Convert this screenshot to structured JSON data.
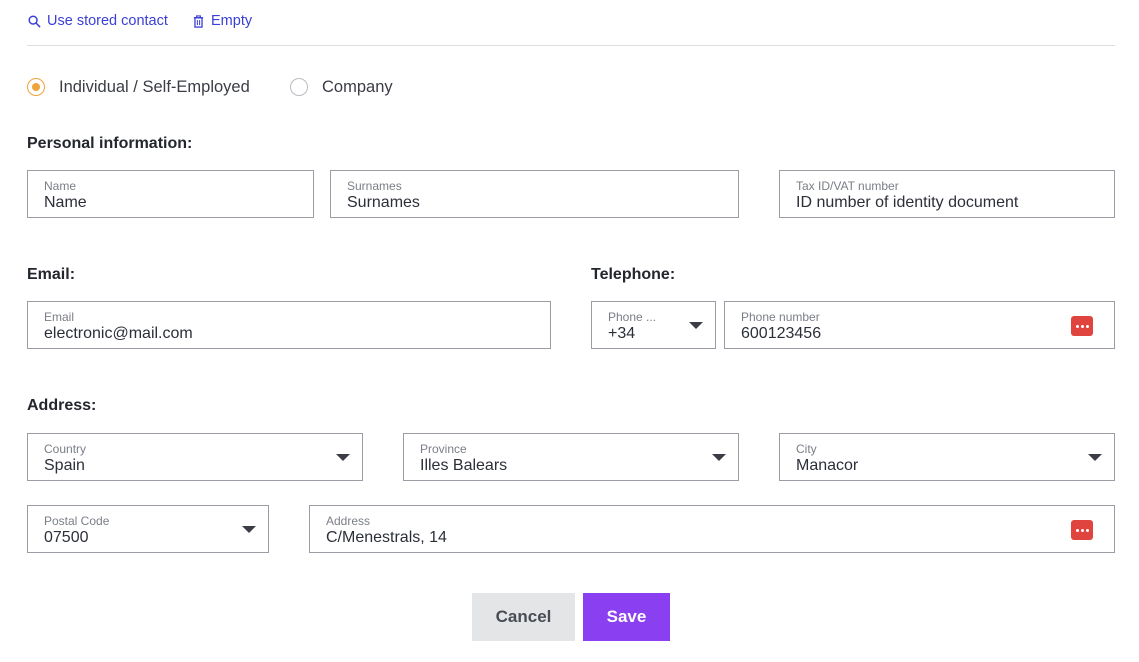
{
  "top_actions": {
    "use_stored_contact": "Use stored contact",
    "empty": "Empty"
  },
  "entity_type": {
    "options": [
      {
        "label": "Individual / Self-Employed",
        "selected": true
      },
      {
        "label": "Company",
        "selected": false
      }
    ]
  },
  "personal": {
    "title": "Personal information:",
    "name": {
      "label": "Name",
      "value": "Name"
    },
    "surnames": {
      "label": "Surnames",
      "value": "Surnames"
    },
    "tax_id": {
      "label": "Tax ID/VAT number",
      "value": "ID number of identity document"
    }
  },
  "email": {
    "title": "Email:",
    "field": {
      "label": "Email",
      "value": "electronic@mail.com"
    }
  },
  "telephone": {
    "title": "Telephone:",
    "prefix": {
      "label": "Phone ...",
      "value": "+34"
    },
    "number": {
      "label": "Phone number",
      "value": "600123456"
    }
  },
  "address": {
    "title": "Address:",
    "country": {
      "label": "Country",
      "value": "Spain"
    },
    "province": {
      "label": "Province",
      "value": "Illes Balears"
    },
    "city": {
      "label": "City",
      "value": "Manacor"
    },
    "postal_code": {
      "label": "Postal Code",
      "value": "07500"
    },
    "street": {
      "label": "Address",
      "value": "C/Menestrals, 14"
    }
  },
  "buttons": {
    "cancel": "Cancel",
    "save": "Save"
  },
  "colors": {
    "accent": "#8a3ff0",
    "link": "#3a3fd6",
    "radio_selected": "#f0a23b",
    "warning_button": "#e0443e"
  }
}
